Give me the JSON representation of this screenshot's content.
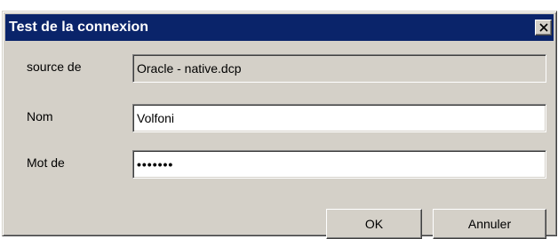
{
  "window": {
    "title": "Test de la connexion",
    "close_icon": "close-icon"
  },
  "form": {
    "source": {
      "label": "source de",
      "value": "Oracle - native.dcp"
    },
    "name": {
      "label": "Nom",
      "value": "Volfoni"
    },
    "password": {
      "label": "Mot de",
      "value": "•••••••"
    }
  },
  "buttons": {
    "ok_label": "OK",
    "cancel_label": "Annuler"
  },
  "colors": {
    "titlebar": "#0a246a",
    "dialog_bg": "#d4d0c8"
  }
}
